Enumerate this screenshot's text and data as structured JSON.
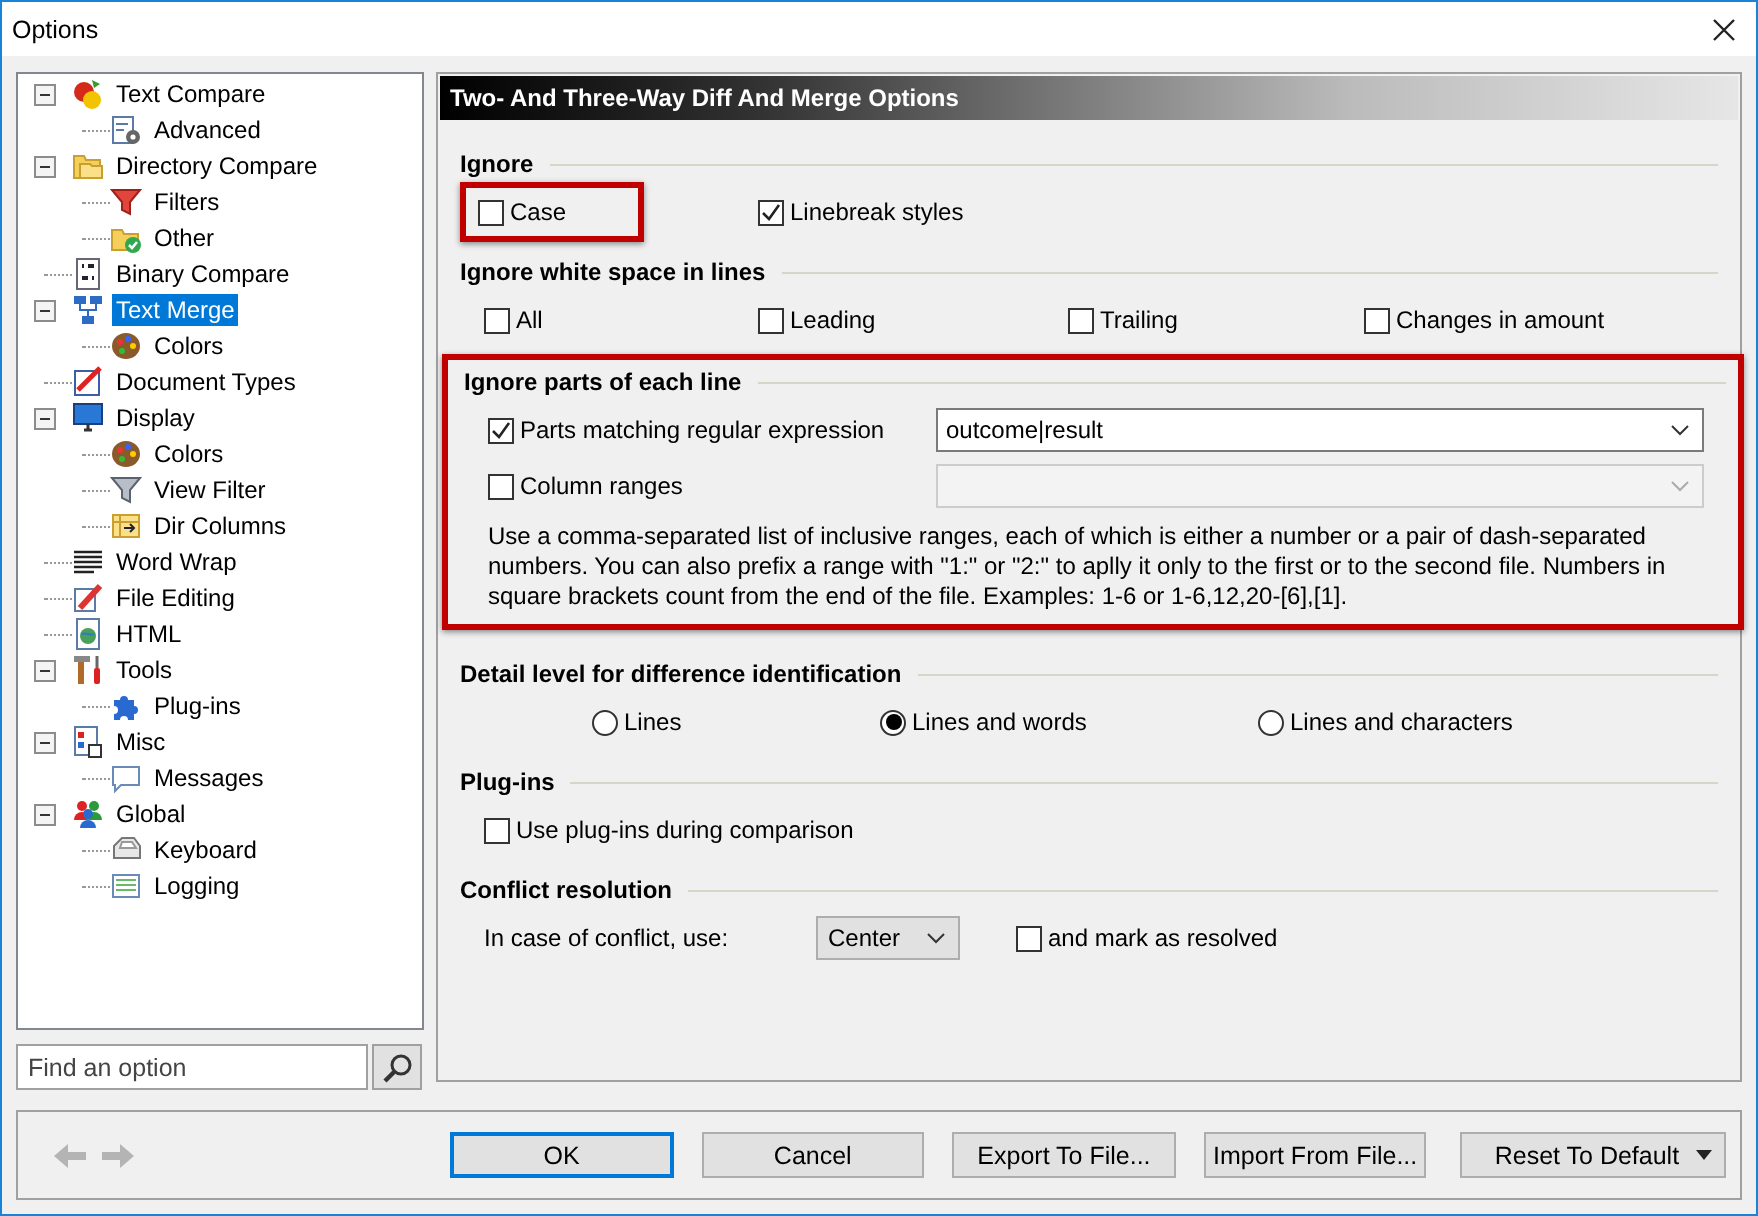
{
  "window": {
    "title": "Options"
  },
  "tree": {
    "items": [
      {
        "label": "Text Compare",
        "selected": false,
        "expanded": true,
        "children": [
          {
            "label": "Advanced",
            "selected": false
          }
        ]
      },
      {
        "label": "Directory Compare",
        "selected": false,
        "expanded": true,
        "children": [
          {
            "label": "Filters",
            "selected": false
          },
          {
            "label": "Other",
            "selected": false
          }
        ]
      },
      {
        "label": "Binary Compare",
        "selected": false
      },
      {
        "label": "Text Merge",
        "selected": true,
        "expanded": true,
        "children": [
          {
            "label": "Colors",
            "selected": false
          }
        ]
      },
      {
        "label": "Document Types",
        "selected": false
      },
      {
        "label": "Display",
        "selected": false,
        "expanded": true,
        "children": [
          {
            "label": "Colors",
            "selected": false
          },
          {
            "label": "View Filter",
            "selected": false
          },
          {
            "label": "Dir Columns",
            "selected": false
          }
        ]
      },
      {
        "label": "Word Wrap",
        "selected": false
      },
      {
        "label": "File Editing",
        "selected": false
      },
      {
        "label": "HTML",
        "selected": false
      },
      {
        "label": "Tools",
        "selected": false,
        "expanded": true,
        "children": [
          {
            "label": "Plug-ins",
            "selected": false
          }
        ]
      },
      {
        "label": "Misc",
        "selected": false,
        "expanded": true,
        "children": [
          {
            "label": "Messages",
            "selected": false
          }
        ]
      },
      {
        "label": "Global",
        "selected": false,
        "expanded": true,
        "children": [
          {
            "label": "Keyboard",
            "selected": false
          },
          {
            "label": "Logging",
            "selected": false
          }
        ]
      }
    ]
  },
  "search": {
    "placeholder": "Find an option"
  },
  "page": {
    "title": "Two- And Three-Way Diff And Merge Options",
    "sections": [
      {
        "title": "Ignore",
        "highlighted": false,
        "rows": [
          {
            "kind": "columns",
            "items": [
              {
                "kind": "checkbox",
                "label": "Case",
                "checked": false,
                "highlighted": true
              },
              {
                "kind": "checkbox",
                "label": "Linebreak styles",
                "checked": true,
                "highlighted": false
              }
            ]
          }
        ]
      },
      {
        "title": "Ignore white space in lines",
        "highlighted": false,
        "rows": [
          {
            "kind": "columns",
            "items": [
              {
                "kind": "checkbox",
                "label": "All",
                "checked": false,
                "highlighted": false
              },
              {
                "kind": "checkbox",
                "label": "Leading",
                "checked": false,
                "highlighted": false
              },
              {
                "kind": "checkbox",
                "label": "Trailing",
                "checked": false,
                "highlighted": false
              },
              {
                "kind": "checkbox",
                "label": "Changes in amount",
                "checked": false,
                "highlighted": false
              }
            ]
          }
        ]
      },
      {
        "title": "Ignore parts of each line",
        "highlighted": true,
        "rows": [
          {
            "kind": "field",
            "items": [
              {
                "kind": "checkbox",
                "label": "Parts matching regular expression",
                "checked": true,
                "highlighted": false
              },
              {
                "kind": "combo",
                "value": "outcome|result",
                "disabled": false
              }
            ]
          },
          {
            "kind": "field",
            "items": [
              {
                "kind": "checkbox",
                "label": "Column ranges",
                "checked": false,
                "highlighted": false
              },
              {
                "kind": "combo",
                "disabled": true
              }
            ]
          },
          {
            "kind": "note",
            "items": [
              {
                "kind": "note",
                "text": "Use a comma-separated list of inclusive ranges, each of which is either a number or a pair of dash-separated numbers. You can also prefix a range with \"1:\" or \"2:\" to aplly it only to the first or to the second file. Numbers in square brackets count from the end of the file. Examples: 1-6 or 1-6,12,20-[6],[1]."
              }
            ]
          }
        ]
      },
      {
        "title": "Detail level for difference identification",
        "highlighted": false,
        "rows": [
          {
            "kind": "radios",
            "items": [
              {
                "kind": "radio",
                "label": "Lines",
                "selected": false
              },
              {
                "kind": "radio",
                "label": "Lines and words",
                "selected": true
              },
              {
                "kind": "radio",
                "label": "Lines and characters",
                "selected": false
              }
            ]
          }
        ]
      },
      {
        "title": "Plug-ins",
        "highlighted": false,
        "rows": [
          {
            "kind": "columns",
            "items": [
              {
                "kind": "checkbox",
                "label": "Use plug-ins during comparison",
                "checked": false,
                "highlighted": false
              }
            ]
          }
        ]
      },
      {
        "title": "Conflict resolution",
        "highlighted": false,
        "rows": [
          {
            "kind": "conflict",
            "items": [
              {
                "kind": "label",
                "text": "In case of conflict, use:"
              },
              {
                "kind": "select",
                "value": "Center"
              },
              {
                "kind": "checkbox",
                "label": "and mark as resolved",
                "checked": false,
                "highlighted": false
              }
            ]
          }
        ]
      }
    ]
  },
  "buttons": [
    {
      "label": "OK",
      "kind": "default"
    },
    {
      "label": "Cancel",
      "kind": "plain"
    },
    {
      "label": "Export To File...",
      "kind": "plain"
    },
    {
      "label": "Import From File...",
      "kind": "plain"
    },
    {
      "label": "Reset To Default",
      "kind": "split"
    }
  ]
}
